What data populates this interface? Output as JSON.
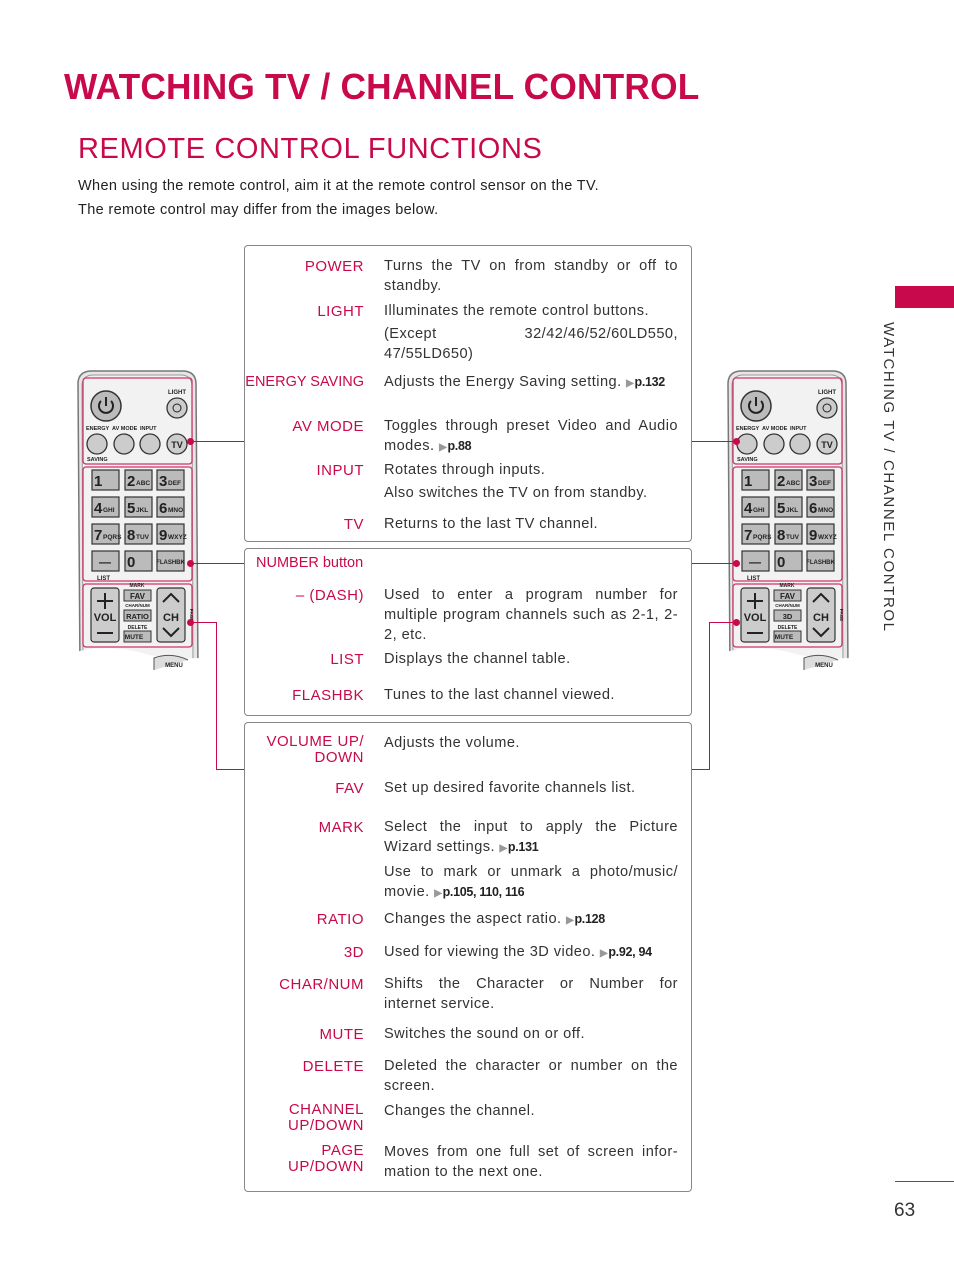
{
  "header": {
    "title": "WATCHING TV / CHANNEL CONTROL",
    "subtitle": "REMOTE CONTROL FUNCTIONS",
    "intro": [
      "When using the remote control, aim it at the remote control sensor on the TV.",
      "The remote control may differ from the images below."
    ]
  },
  "side_tab": {
    "text": "WATCHING TV / CHANNEL CONTROL"
  },
  "page_number": "63",
  "colors": {
    "accent": "#c8094c",
    "text": "#333333",
    "border": "#888888"
  },
  "boxes": [
    {
      "heading": "",
      "rows": [
        {
          "label": "POWER",
          "desc": [
            {
              "text": "Turns the TV on from standby or off to standby."
            }
          ]
        },
        {
          "label": "LIGHT",
          "desc": [
            {
              "text": "Illuminates the remote control buttons."
            },
            {
              "text": "(Except 32/42/46/52/60LD550, 47/55LD650)"
            }
          ]
        },
        {
          "label": "ENERGY SAVING",
          "desc": [
            {
              "text": "Adjusts the Energy Saving setting.",
              "ref": "p.132"
            }
          ]
        },
        {
          "label": "AV MODE",
          "desc": [
            {
              "text": "Toggles through preset Video and Audio modes.",
              "ref": "p.88"
            }
          ]
        },
        {
          "label": "INPUT",
          "desc": [
            {
              "text": "Rotates through inputs."
            },
            {
              "text": "Also switches the TV on from standby."
            }
          ]
        },
        {
          "label": "TV",
          "desc": [
            {
              "text": "Returns to the last TV channel."
            }
          ]
        }
      ]
    },
    {
      "heading": "NUMBER button",
      "rows": [
        {
          "label": "– (DASH)",
          "desc": [
            {
              "text": "Used to enter a program number for multiple program channels such as 2-1, 2-2, etc."
            }
          ]
        },
        {
          "label": "LIST",
          "desc": [
            {
              "text": "Displays the channel table."
            }
          ]
        },
        {
          "label": "FLASHBK",
          "desc": [
            {
              "text": "Tunes to the last channel viewed."
            }
          ]
        }
      ]
    },
    {
      "heading": "",
      "rows": [
        {
          "label": "VOLUME UP/\nDOWN",
          "desc": [
            {
              "text": "Adjusts the volume."
            }
          ]
        },
        {
          "label": "FAV",
          "desc": [
            {
              "text": "Set up desired favorite channels list."
            }
          ]
        },
        {
          "label": "MARK",
          "desc": [
            {
              "text": "Select the input to apply the Picture Wizard settings.",
              "ref": "p.131"
            },
            {
              "text": "Use to mark or unmark a photo/music/ movie.",
              "ref": "p.105, 110, 116"
            }
          ]
        },
        {
          "label": "RATIO",
          "desc": [
            {
              "text": "Changes the aspect ratio.",
              "ref": "p.128"
            }
          ]
        },
        {
          "label": "3D",
          "desc": [
            {
              "text": "Used for viewing the 3D video.",
              "ref": "p.92, 94"
            }
          ]
        },
        {
          "label": "CHAR/NUM",
          "desc": [
            {
              "text": "Shifts the Character or Number for internet service."
            }
          ]
        },
        {
          "label": "MUTE",
          "desc": [
            {
              "text": "Switches the sound on or off."
            }
          ]
        },
        {
          "label": "DELETE",
          "desc": [
            {
              "text": "Deleted the character or number on the screen."
            }
          ]
        },
        {
          "label": "CHANNEL\nUP/DOWN",
          "desc": [
            {
              "text": "Changes the channel."
            }
          ]
        },
        {
          "label": "PAGE\nUP/DOWN",
          "desc": [
            {
              "text": "Moves from one full set of screen infor-mation to the next one."
            }
          ]
        }
      ]
    }
  ],
  "remotes": [
    {
      "light": "LIGHT",
      "energy": "ENERGY",
      "saving": "SAVING",
      "avmode": "AV MODE",
      "input": "INPUT",
      "tv": "TV",
      "keys": [
        [
          "1",
          ""
        ],
        [
          "2",
          "ABC"
        ],
        [
          "3",
          "DEF"
        ],
        [
          "4",
          "GHI"
        ],
        [
          "5",
          "JKL"
        ],
        [
          "6",
          "MNO"
        ],
        [
          "7",
          "PQRS"
        ],
        [
          "8",
          "TUV"
        ],
        [
          "9",
          "WXYZ"
        ]
      ],
      "dash": "—",
      "zero": "0",
      "flashbk": "FLASHBK",
      "list": "LIST",
      "mark": "MARK",
      "fav": "FAV",
      "charnum": "CHAR/NUM",
      "mid": "RATIO",
      "delete": "DELETE",
      "mute": "MUTE",
      "vol": "VOL",
      "ch": "CH",
      "page": "PAGE",
      "menu": "MENU"
    },
    {
      "light": "LIGHT",
      "energy": "ENERGY",
      "saving": "SAVING",
      "avmode": "AV MODE",
      "input": "INPUT",
      "tv": "TV",
      "keys": [
        [
          "1",
          ""
        ],
        [
          "2",
          "ABC"
        ],
        [
          "3",
          "DEF"
        ],
        [
          "4",
          "GHI"
        ],
        [
          "5",
          "JKL"
        ],
        [
          "6",
          "MNO"
        ],
        [
          "7",
          "PQRS"
        ],
        [
          "8",
          "TUV"
        ],
        [
          "9",
          "WXYZ"
        ]
      ],
      "dash": "—",
      "zero": "0",
      "flashbk": "FLASHBK",
      "list": "LIST",
      "mark": "MARK",
      "fav": "FAV",
      "charnum": "CHAR/NUM",
      "mid": "3D",
      "delete": "DELETE",
      "mute": "MUTE",
      "vol": "VOL",
      "ch": "CH",
      "page": "PAGE",
      "menu": "MENU"
    }
  ]
}
